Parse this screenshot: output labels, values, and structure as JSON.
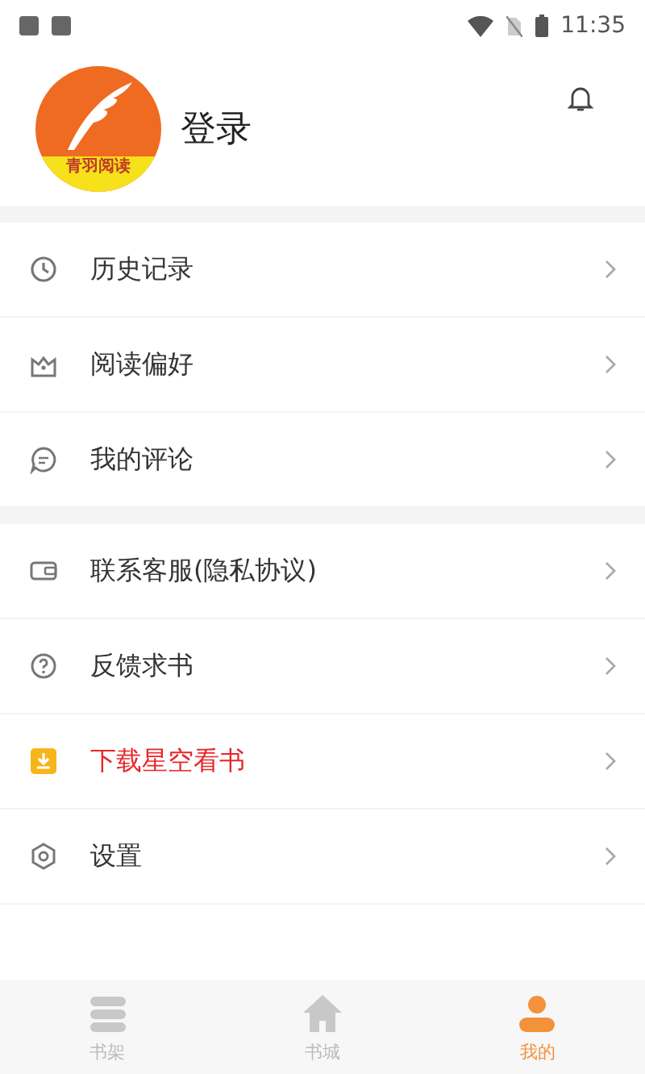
{
  "status_bar": {
    "time": "11:35"
  },
  "profile": {
    "logo_text": "青羽阅读",
    "login": "登录"
  },
  "menu_groups": [
    {
      "items": [
        {
          "label": "历史记录",
          "highlighted": false
        },
        {
          "label": "阅读偏好",
          "highlighted": false
        },
        {
          "label": "我的评论",
          "highlighted": false
        }
      ]
    },
    {
      "items": [
        {
          "label": "联系客服(隐私协议)",
          "highlighted": false
        },
        {
          "label": "反馈求书",
          "highlighted": false
        },
        {
          "label": "下载星空看书",
          "highlighted": true
        },
        {
          "label": "设置",
          "highlighted": false
        }
      ]
    }
  ],
  "bottom_nav": [
    {
      "label": "书架",
      "selected": false
    },
    {
      "label": "书城",
      "selected": false
    },
    {
      "label": "我的",
      "selected": true
    }
  ]
}
